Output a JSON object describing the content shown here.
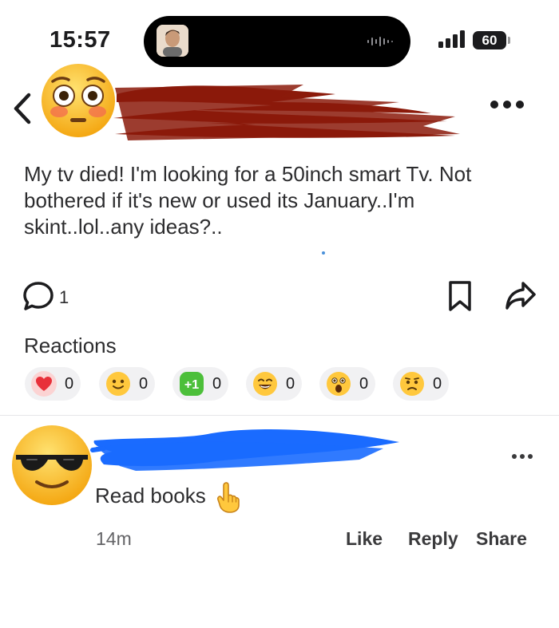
{
  "status_bar": {
    "time": "15:57",
    "battery": "60"
  },
  "post": {
    "body": "My tv died!  I'm looking for a 50inch smart Tv.  Not bothered if it's new or used  its January..I'm skint..lol..any ideas?..",
    "comment_count": "1",
    "author_avatar_icon": "flushed-face-emoji",
    "author_name_redaction_color": "#8b1a0a"
  },
  "reactions": {
    "title": "Reactions",
    "items": [
      {
        "icon": "heart-icon",
        "count": "0"
      },
      {
        "icon": "smile-icon",
        "count": "0"
      },
      {
        "icon": "plus-one-icon",
        "label": "+1",
        "count": "0"
      },
      {
        "icon": "grin-icon",
        "count": "0"
      },
      {
        "icon": "wow-icon",
        "count": "0"
      },
      {
        "icon": "sad-icon",
        "count": "0"
      }
    ]
  },
  "comment": {
    "avatar_icon": "sunglasses-face-emoji",
    "author_redaction_color": "#1a6bff",
    "text": "Read books",
    "emoji_icon": "pointing-up-emoji",
    "time": "14m",
    "like": "Like",
    "reply": "Reply",
    "share": "Share"
  }
}
